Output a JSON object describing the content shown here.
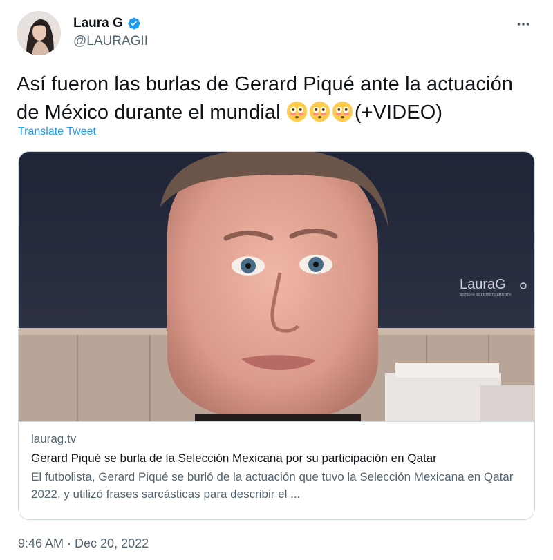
{
  "author": {
    "display_name": "Laura G",
    "handle": "@LAURAGII",
    "verified": true,
    "avatar_icon": "profile-avatar"
  },
  "menu_icon": "more-options-icon",
  "tweet": {
    "text": "Así fueron las burlas de Gerard Piqué ante la actuación de México durante el mundial",
    "emoji": [
      "😳",
      "😳",
      "😳"
    ],
    "text_suffix": "(+VIDEO)",
    "translate_label": "Translate Tweet"
  },
  "card": {
    "watermark": "LauraG",
    "watermark_sub": "NOTICIAS DE ENTRETENIMIENTO",
    "domain": "laurag.tv",
    "title": "Gerard Piqué se burla de la Selección Mexicana por su participación en Qatar",
    "description": "El futbolista, Gerard Piqué se burló de la actuación que tuvo la Selección Mexicana en Qatar 2022, y utilizó frases sarcásticas para describir el ..."
  },
  "timestamp": "9:46 AM · Dec 20, 2022",
  "colors": {
    "accent": "#1d9bf0",
    "text": "#0f1419",
    "secondary": "#536471",
    "border": "#cfd9de"
  }
}
